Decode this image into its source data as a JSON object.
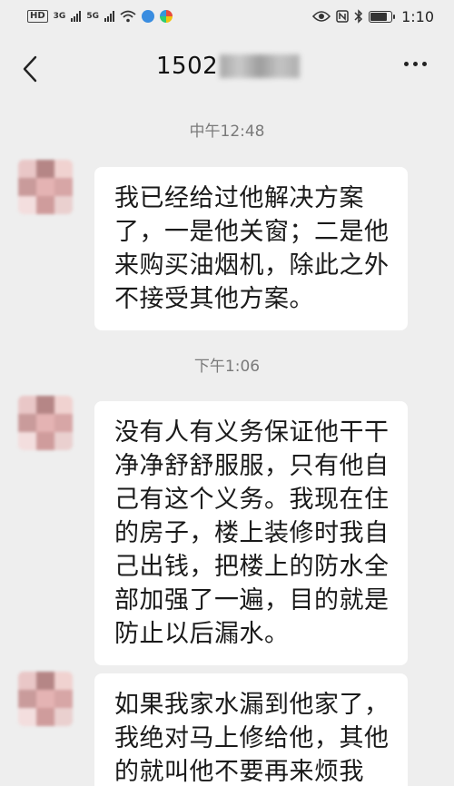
{
  "status_bar": {
    "hd_tag": "HD",
    "sim1_net": "3G",
    "sim2_net": "5G",
    "time": "1:10",
    "icons": [
      "hd-icon",
      "signal-icon",
      "signal-icon",
      "wifi-icon",
      "app-icon",
      "app-icon",
      "eye-icon",
      "nfc-icon",
      "bluetooth-icon",
      "battery-icon"
    ]
  },
  "header": {
    "contact_visible": "1502",
    "back_icon": "chevron-left-icon",
    "more_icon": "more-horizontal-icon"
  },
  "messages": [
    {
      "time": "中午12:48",
      "lines": [
        "我已经给过他解决方案",
        "了，一是他关窗；二是他",
        "来购买油烟机，除此之外",
        "不接受其他方案。"
      ]
    },
    {
      "time": "下午1:06",
      "lines": [
        "没有人有义务保证他干干",
        "净净舒舒服服，只有他自",
        "己有这个义务。我现在住",
        "的房子，楼上装修时我自",
        "己出钱，把楼上的防水全",
        "部加强了一遍，目的就是",
        "防止以后漏水。"
      ]
    },
    {
      "time": "",
      "lines": [
        "如果我家水漏到他家了，",
        "我绝对马上修给他，其他",
        "的就叫他不要再来烦我"
      ]
    }
  ],
  "colors": {
    "background": "#eeeeee",
    "bubble": "#ffffff",
    "time_label": "#7a7a7a",
    "avatar_palette": [
      "#e9c7c7",
      "#b58686",
      "#f0d2d0",
      "#c99b9b",
      "#e4b3b3",
      "#d7a6a6",
      "#f3dede",
      "#cf9c9c",
      "#ead0cf"
    ]
  }
}
